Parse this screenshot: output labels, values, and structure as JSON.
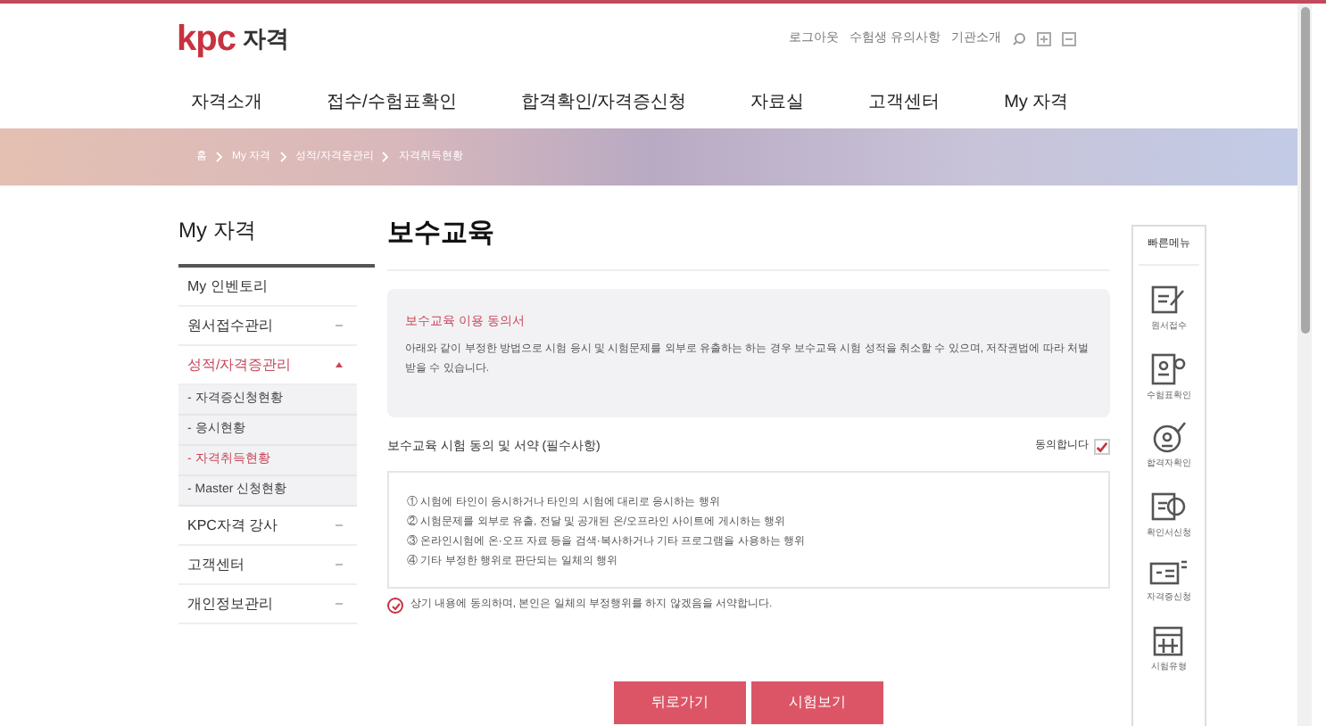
{
  "header": {
    "logo": "kpc",
    "logo_suffix": "자격",
    "top_links": [
      "로그아웃",
      "수험생 유의사항",
      "기관소개"
    ]
  },
  "nav": [
    "자격소개",
    "접수/수험표확인",
    "합격확인/자격증신청",
    "자료실",
    "고객센터",
    "My 자격"
  ],
  "breadcrumb": [
    "홈",
    "My 자격",
    "성적/자격증관리",
    "자격취득현황"
  ],
  "sidebar": {
    "title": "My 자격",
    "items": [
      {
        "label": "My 인벤토리",
        "selected": false
      },
      {
        "label": "원서접수관리",
        "selected": false,
        "expanded": false
      },
      {
        "label": "성적/자격증관리",
        "selected": true,
        "expanded": true,
        "children": [
          {
            "label": "- 자격증신청현황",
            "selected": false
          },
          {
            "label": "- 응시현황",
            "selected": false
          },
          {
            "label": "- 자격취득현황",
            "selected": true
          },
          {
            "label": "- Master 신청현황",
            "selected": false
          }
        ]
      },
      {
        "label": "KPC자격 강사",
        "selected": false,
        "expanded": false
      },
      {
        "label": "고객센터",
        "selected": false,
        "expanded": false
      },
      {
        "label": "개인정보관리",
        "selected": false,
        "expanded": false
      }
    ]
  },
  "main": {
    "title": "보수교육",
    "notice": {
      "title": "보수교육 이용 동의서",
      "body": "아래와 같이 부정한 방법으로 시험 응시 및 시험문제를 외부로 유출하는 하는 경우 보수교육 시험 성적을 취소할 수 있으며, 저작권법에 따라 처벌받을 수 있습니다."
    },
    "agreement": {
      "label": "보수교육 시험 동의 및 서약 (필수사항)",
      "agree_label": "동의합니다",
      "checked": true
    },
    "rules": [
      "① 시험에 타인이 응시하거나 타인의 시험에 대리로 응시하는 행위",
      "② 시험문제를 외부로 유출, 전달 및 공개된 온/오프라인 사이트에 게시하는 행위",
      "③ 온라인시험에 온·오프 자료 등을 검색·복사하거나 기타 프로그램을 사용하는 행위",
      "④ 기타 부정한 행위로 판단되는 일체의 행위"
    ],
    "pledge": {
      "text": "상기 내용에 동의하며, 본인은 일체의 부정행위를 하지 않겠음을 서약합니다.",
      "checked": true
    },
    "buttons": [
      "뒤로가기",
      "시험보기"
    ]
  },
  "quick_menu": {
    "title": "빠른메뉴",
    "items": [
      {
        "label": "원서접수",
        "kind": "form"
      },
      {
        "label": "수험표확인",
        "kind": "ticket"
      },
      {
        "label": "합격자확인",
        "kind": "pass"
      },
      {
        "label": "확인서신청",
        "kind": "cert"
      },
      {
        "label": "자격증신청",
        "kind": "card"
      },
      {
        "label": "시험유형",
        "kind": "calendar"
      }
    ]
  }
}
